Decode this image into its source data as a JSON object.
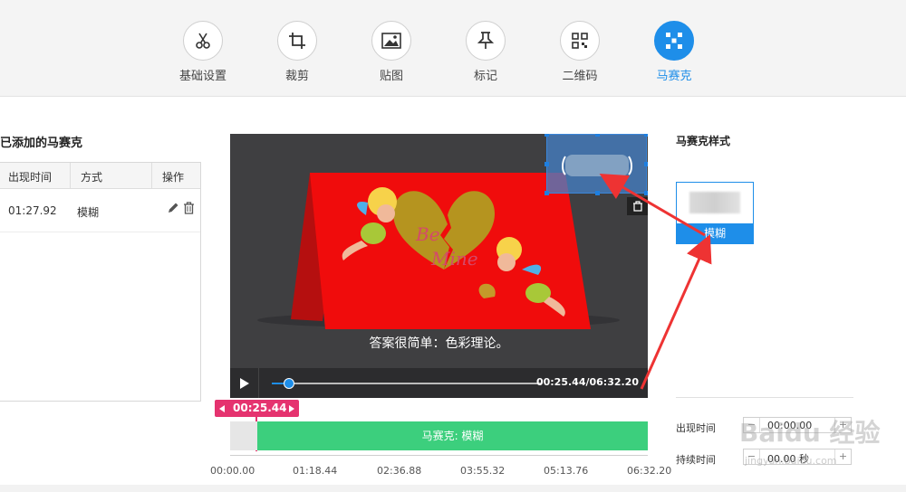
{
  "toolbar": {
    "items": [
      {
        "label": "基础设置",
        "icon": "scissors-icon"
      },
      {
        "label": "裁剪",
        "icon": "crop-icon"
      },
      {
        "label": "贴图",
        "icon": "image-icon"
      },
      {
        "label": "标记",
        "icon": "pin-icon"
      },
      {
        "label": "二维码",
        "icon": "qrcode-icon"
      },
      {
        "label": "马赛克",
        "icon": "mosaic-icon",
        "active": true
      }
    ],
    "accent": "#1e8ee9"
  },
  "left_panel": {
    "title": "已添加的马赛克",
    "columns": [
      "出现时间",
      "方式",
      "操作"
    ],
    "rows": [
      {
        "time": "01:27.92",
        "mode": "模糊"
      }
    ]
  },
  "video": {
    "subtitle": "答案很简单：色彩理论。",
    "timecode": "00:25.44/06:32.20",
    "progress": 0.065,
    "card_text_1": "Be",
    "card_text_2": "Mine"
  },
  "timeline": {
    "playhead": "00:25.44",
    "segment_label": "马赛克: 模糊",
    "ticks": [
      "00:00.00",
      "01:18.44",
      "02:36.88",
      "03:55.32",
      "05:13.76",
      "06:32.20"
    ],
    "segment_color": "#3ccf7d",
    "playhead_color": "#e5336f"
  },
  "right_panel": {
    "title": "马赛克样式",
    "style_label": "模糊",
    "appear_label": "出现时间",
    "appear_value": "00:00.00",
    "duration_label": "持续时间",
    "duration_value": "00.00 秒"
  },
  "watermark": {
    "main": "Baidu 经验",
    "sub": "jingyan.baidu.com"
  }
}
